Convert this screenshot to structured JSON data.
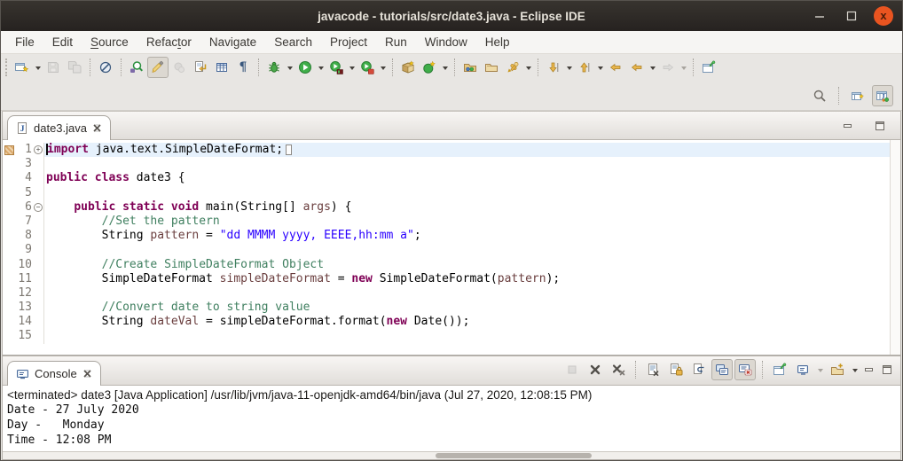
{
  "window": {
    "title": "javacode - tutorials/src/date3.java - Eclipse IDE",
    "controls": [
      "minimize",
      "maximize",
      "close"
    ],
    "close_glyph": "x",
    "close_color": "#e95420"
  },
  "menubar": {
    "items": [
      {
        "label": "File",
        "u": -1
      },
      {
        "label": "Edit",
        "u": -1
      },
      {
        "label": "Source",
        "u": 0
      },
      {
        "label": "Refactor",
        "u": 5
      },
      {
        "label": "Navigate",
        "u": -1
      },
      {
        "label": "Search",
        "u": -1
      },
      {
        "label": "Project",
        "u": -1
      },
      {
        "label": "Run",
        "u": -1
      },
      {
        "label": "Window",
        "u": -1
      },
      {
        "label": "Help",
        "u": -1
      }
    ]
  },
  "toolbar": {
    "whitespace_glyph": "¶",
    "main_icons": [
      "new-wizard",
      "save",
      "save-all",
      "skip-all-breakpoints",
      "open-plugin-artifact",
      "mark-occurrences",
      "smart-insert",
      "build-directives",
      "open-element-table",
      "show-whitespace",
      "debug",
      "run",
      "coverage",
      "profile",
      "new-java-project",
      "new-java-class",
      "open-type-hierarchy",
      "open-resource",
      "link-with-editor",
      "next-annotation",
      "previous-annotation",
      "last-edit-location",
      "back",
      "forward",
      "pin-editor"
    ],
    "disabled_icons": [
      "save",
      "save-all",
      "smart-insert",
      "forward"
    ],
    "toggled_on_icons": [
      "mark-occurrences"
    ],
    "right_icons": [
      "search",
      "open-perspective",
      "java-perspective"
    ],
    "active_perspective": "java-perspective"
  },
  "editor": {
    "tab": {
      "label": "date3.java"
    },
    "lines": [
      {
        "n": "1",
        "fold": "+",
        "marker": true,
        "highlight": true,
        "cursor": true,
        "tokens": [
          {
            "t": "import",
            "c": "k"
          },
          {
            "t": " java.text.SimpleDateFormat;",
            "c": "p"
          },
          {
            "t": "",
            "c": "box"
          }
        ]
      },
      {
        "n": "3",
        "tokens": []
      },
      {
        "n": "4",
        "tokens": [
          {
            "t": "public class",
            "c": "k"
          },
          {
            "t": " date3 {",
            "c": "p"
          }
        ]
      },
      {
        "n": "5",
        "tokens": []
      },
      {
        "n": "6",
        "fold": "-",
        "tokens": [
          {
            "t": "    ",
            "c": "p"
          },
          {
            "t": "public static void",
            "c": "k"
          },
          {
            "t": " main(String[] ",
            "c": "p"
          },
          {
            "t": "args",
            "c": "v"
          },
          {
            "t": ") {",
            "c": "p"
          }
        ]
      },
      {
        "n": "7",
        "tokens": [
          {
            "t": "        ",
            "c": "p"
          },
          {
            "t": "//Set the pattern",
            "c": "c"
          }
        ]
      },
      {
        "n": "8",
        "tokens": [
          {
            "t": "        String ",
            "c": "p"
          },
          {
            "t": "pattern",
            "c": "v"
          },
          {
            "t": " = ",
            "c": "p"
          },
          {
            "t": "\"dd MMMM yyyy, EEEE,hh:mm a\"",
            "c": "s"
          },
          {
            "t": ";",
            "c": "p"
          }
        ]
      },
      {
        "n": "9",
        "tokens": []
      },
      {
        "n": "10",
        "tokens": [
          {
            "t": "        ",
            "c": "p"
          },
          {
            "t": "//Create SimpleDateFormat Object",
            "c": "c"
          }
        ]
      },
      {
        "n": "11",
        "tokens": [
          {
            "t": "        SimpleDateFormat ",
            "c": "p"
          },
          {
            "t": "simpleDateFormat",
            "c": "v"
          },
          {
            "t": " = ",
            "c": "p"
          },
          {
            "t": "new",
            "c": "k"
          },
          {
            "t": " SimpleDateFormat(",
            "c": "p"
          },
          {
            "t": "pattern",
            "c": "v"
          },
          {
            "t": ");",
            "c": "p"
          }
        ]
      },
      {
        "n": "12",
        "tokens": []
      },
      {
        "n": "13",
        "tokens": [
          {
            "t": "        ",
            "c": "p"
          },
          {
            "t": "//Convert date to string value",
            "c": "c"
          }
        ]
      },
      {
        "n": "14",
        "tokens": [
          {
            "t": "        String ",
            "c": "p"
          },
          {
            "t": "dateVal",
            "c": "v"
          },
          {
            "t": " = ",
            "c": "p"
          },
          {
            "t": "simpleDateFormat.format(",
            "c": "p"
          },
          {
            "t": "new",
            "c": "k"
          },
          {
            "t": " Date());",
            "c": "p"
          }
        ]
      },
      {
        "n": "15",
        "tokens": []
      }
    ]
  },
  "console": {
    "tab": {
      "label": "Console"
    },
    "toolbar_icons": [
      "terminate",
      "remove-launch",
      "remove-all-terminated",
      "clear-console",
      "scroll-lock",
      "word-wrap",
      "show-console-stdout",
      "show-console-stderr",
      "pin-console",
      "display-selected-console",
      "open-console",
      "minimize",
      "maximize"
    ],
    "disabled_icons": [
      "terminate"
    ],
    "toggled_on_icons": [
      "show-console-stdout",
      "show-console-stderr"
    ],
    "header": "<terminated> date3 [Java Application] /usr/lib/jvm/java-11-openjdk-amd64/bin/java (Jul 27, 2020, 12:08:15 PM)",
    "output": [
      "Date - 27 July 2020",
      "Day -   Monday",
      "Time - 12:08 PM"
    ]
  },
  "colors": {
    "keyword": "#7f0055",
    "string": "#2a00ff",
    "comment": "#3f7f5f",
    "variable": "#6a3e3e",
    "current_line": "#e6f1fc",
    "titlebar": "#2c2825",
    "close_button": "#e95420"
  }
}
